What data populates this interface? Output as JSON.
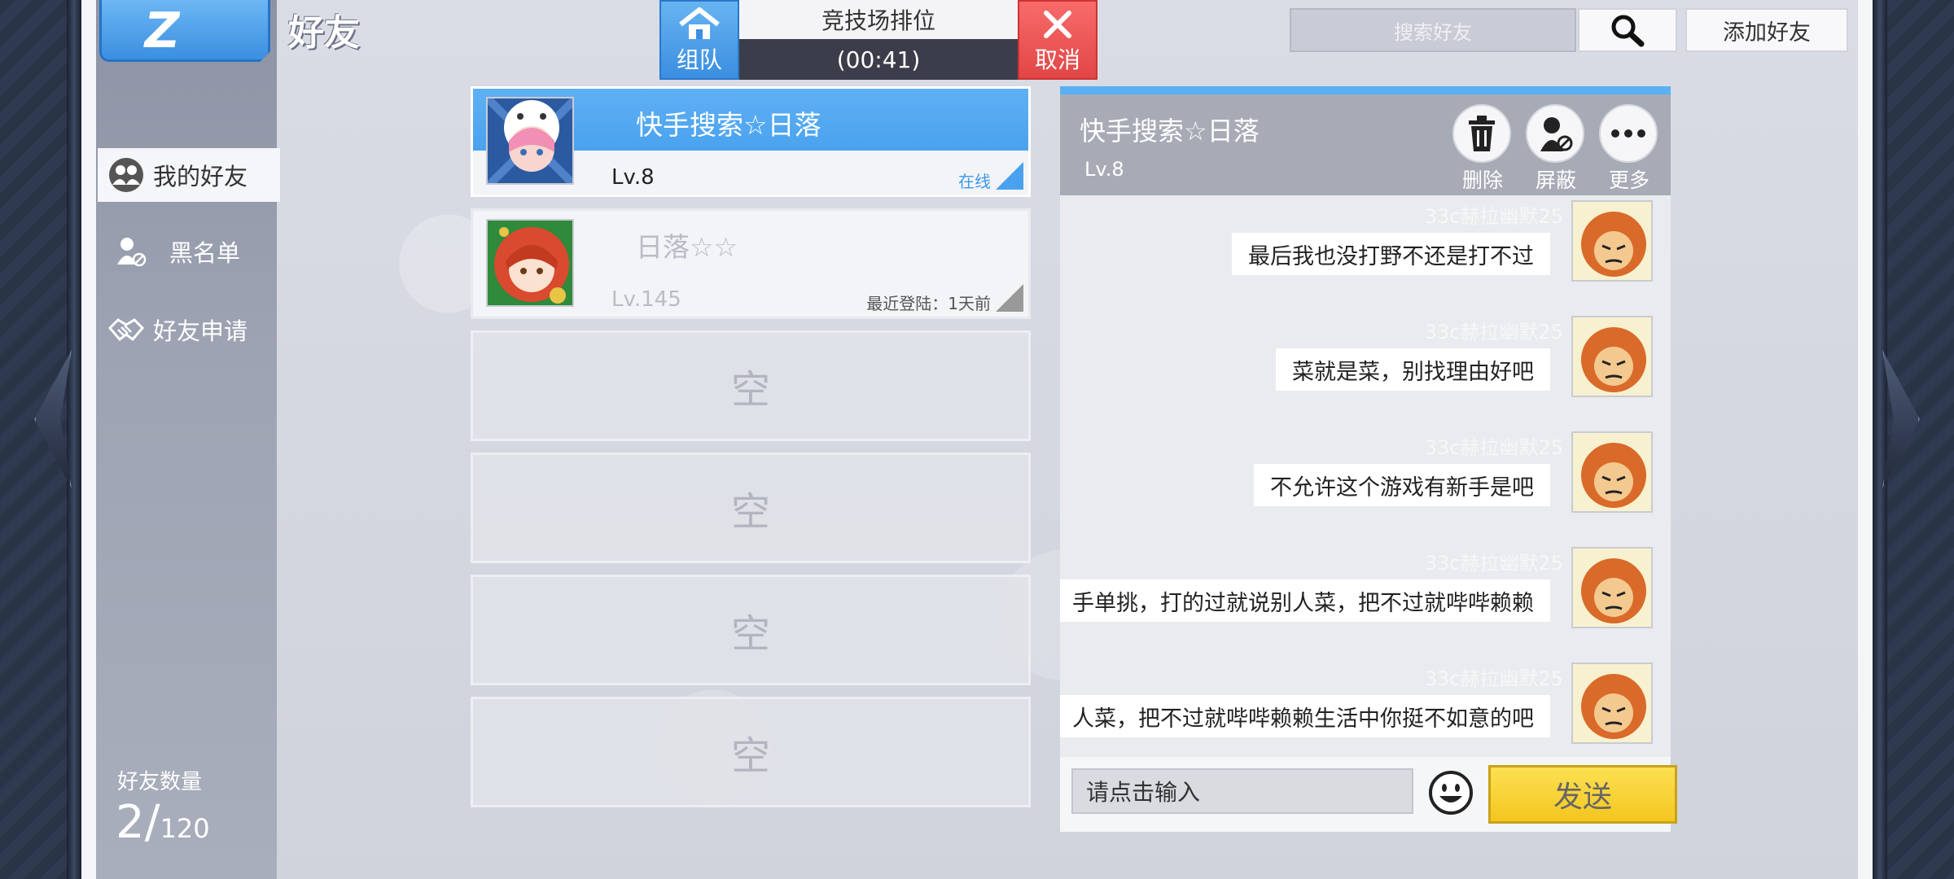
{
  "header": {
    "title": "好友",
    "back_glyph": "Z"
  },
  "match": {
    "team_label": "组队",
    "title": "竞技场排位",
    "timer": "(00:41)",
    "cancel_label": "取消"
  },
  "search": {
    "placeholder": "搜索好友",
    "add_friend_label": "添加好友"
  },
  "sidebar": {
    "items": [
      {
        "label": "我的好友",
        "icon": "friends-icon",
        "active": true
      },
      {
        "label": "黑名单",
        "icon": "blocked-user-icon",
        "active": false
      },
      {
        "label": "好友申请",
        "icon": "handshake-icon",
        "active": false
      }
    ],
    "count_label": "好友数量",
    "count_current": "2/",
    "count_max": "120"
  },
  "friends": [
    {
      "name": "快手搜索☆日落",
      "level": "Lv.8",
      "status": "在线",
      "online": true
    },
    {
      "name": "日落☆☆",
      "level": "Lv.145",
      "status": "最近登陆：1天前",
      "online": false
    }
  ],
  "empty_slots": [
    "空",
    "空",
    "空",
    "空"
  ],
  "chat": {
    "name": "快手搜索☆日落",
    "level": "Lv.8",
    "actions": [
      {
        "label": "删除",
        "icon": "trash-icon"
      },
      {
        "label": "屏蔽",
        "icon": "block-user-icon"
      },
      {
        "label": "更多",
        "icon": "more-icon"
      }
    ],
    "messages": [
      {
        "sender": "33c赫拉幽默25",
        "text": "最后我也没打野不还是打不过"
      },
      {
        "sender": "33c赫拉幽默25",
        "text": "菜就是菜，别找理由好吧"
      },
      {
        "sender": "33c赫拉幽默25",
        "text": "不允许这个游戏有新手是吧"
      },
      {
        "sender": "33c赫拉幽默25",
        "text": "手单挑，打的过就说别人菜，把不过就哔哔赖赖"
      },
      {
        "sender": "33c赫拉幽默25",
        "text": "人菜，把不过就哔哔赖赖生活中你挺不如意的吧"
      }
    ],
    "input_placeholder": "请点击输入",
    "send_label": "发送"
  },
  "colors": {
    "accent_blue": "#4aa2ee",
    "cancel_red": "#e24646",
    "send_yellow": "#f4c61f"
  }
}
